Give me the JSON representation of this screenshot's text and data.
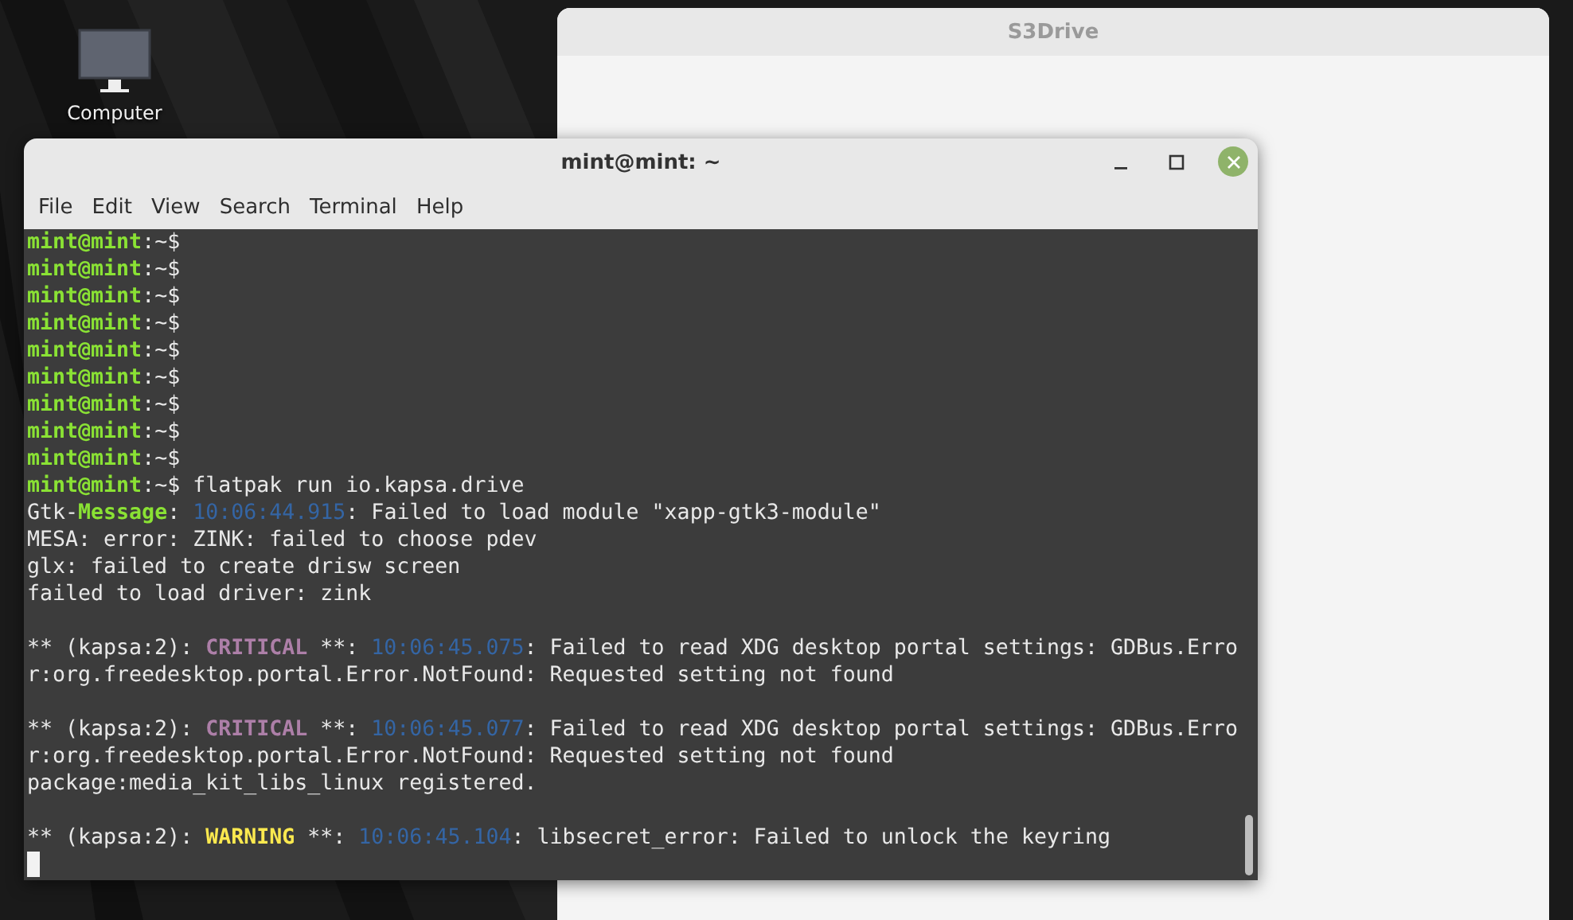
{
  "desktop": {
    "icons": [
      {
        "label": "Computer"
      }
    ]
  },
  "background_window": {
    "title": "S3Drive"
  },
  "terminal": {
    "title": "mint@mint: ~",
    "menu": [
      "File",
      "Edit",
      "View",
      "Search",
      "Terminal",
      "Help"
    ],
    "lines": [
      {
        "segments": [
          {
            "kind": "user",
            "text": "mint@mint"
          },
          {
            "kind": "plain",
            "text": ":~$"
          }
        ]
      },
      {
        "segments": [
          {
            "kind": "user",
            "text": "mint@mint"
          },
          {
            "kind": "plain",
            "text": ":~$"
          }
        ]
      },
      {
        "segments": [
          {
            "kind": "user",
            "text": "mint@mint"
          },
          {
            "kind": "plain",
            "text": ":~$"
          }
        ]
      },
      {
        "segments": [
          {
            "kind": "user",
            "text": "mint@mint"
          },
          {
            "kind": "plain",
            "text": ":~$"
          }
        ]
      },
      {
        "segments": [
          {
            "kind": "user",
            "text": "mint@mint"
          },
          {
            "kind": "plain",
            "text": ":~$"
          }
        ]
      },
      {
        "segments": [
          {
            "kind": "user",
            "text": "mint@mint"
          },
          {
            "kind": "plain",
            "text": ":~$"
          }
        ]
      },
      {
        "segments": [
          {
            "kind": "user",
            "text": "mint@mint"
          },
          {
            "kind": "plain",
            "text": ":~$"
          }
        ]
      },
      {
        "segments": [
          {
            "kind": "user",
            "text": "mint@mint"
          },
          {
            "kind": "plain",
            "text": ":~$"
          }
        ]
      },
      {
        "segments": [
          {
            "kind": "user",
            "text": "mint@mint"
          },
          {
            "kind": "plain",
            "text": ":~$"
          }
        ]
      },
      {
        "segments": [
          {
            "kind": "user",
            "text": "mint@mint"
          },
          {
            "kind": "plain",
            "text": ":~$ flatpak run io.kapsa.drive"
          }
        ]
      },
      {
        "segments": [
          {
            "kind": "plain",
            "text": "Gtk-"
          },
          {
            "kind": "message",
            "text": "Message"
          },
          {
            "kind": "plain",
            "text": ": "
          },
          {
            "kind": "time",
            "text": "10:06:44.915"
          },
          {
            "kind": "plain",
            "text": ": Failed to load module \"xapp-gtk3-module\""
          }
        ]
      },
      {
        "segments": [
          {
            "kind": "plain",
            "text": "MESA: error: ZINK: failed to choose pdev"
          }
        ]
      },
      {
        "segments": [
          {
            "kind": "plain",
            "text": "glx: failed to create drisw screen"
          }
        ]
      },
      {
        "segments": [
          {
            "kind": "plain",
            "text": "failed to load driver: zink"
          }
        ]
      },
      {
        "kind": "blank"
      },
      {
        "segments": [
          {
            "kind": "plain",
            "text": "** (kapsa:2): "
          },
          {
            "kind": "critical",
            "text": "CRITICAL"
          },
          {
            "kind": "plain",
            "text": " **: "
          },
          {
            "kind": "time",
            "text": "10:06:45.075"
          },
          {
            "kind": "plain",
            "text": ": Failed to read XDG desktop portal settings: GDBus.Erro"
          }
        ]
      },
      {
        "segments": [
          {
            "kind": "plain",
            "text": "r:org.freedesktop.portal.Error.NotFound: Requested setting not found"
          }
        ]
      },
      {
        "kind": "blank"
      },
      {
        "segments": [
          {
            "kind": "plain",
            "text": "** (kapsa:2): "
          },
          {
            "kind": "critical",
            "text": "CRITICAL"
          },
          {
            "kind": "plain",
            "text": " **: "
          },
          {
            "kind": "time",
            "text": "10:06:45.077"
          },
          {
            "kind": "plain",
            "text": ": Failed to read XDG desktop portal settings: GDBus.Erro"
          }
        ]
      },
      {
        "segments": [
          {
            "kind": "plain",
            "text": "r:org.freedesktop.portal.Error.NotFound: Requested setting not found"
          }
        ]
      },
      {
        "segments": [
          {
            "kind": "plain",
            "text": "package:media_kit_libs_linux registered."
          }
        ]
      },
      {
        "kind": "blank"
      },
      {
        "segments": [
          {
            "kind": "plain",
            "text": "** (kapsa:2): "
          },
          {
            "kind": "warning",
            "text": "WARNING"
          },
          {
            "kind": "plain",
            "text": " **: "
          },
          {
            "kind": "time",
            "text": "10:06:45.104"
          },
          {
            "kind": "plain",
            "text": ": libsecret_error: Failed to unlock the keyring"
          }
        ]
      },
      {
        "kind": "cursor"
      }
    ]
  }
}
